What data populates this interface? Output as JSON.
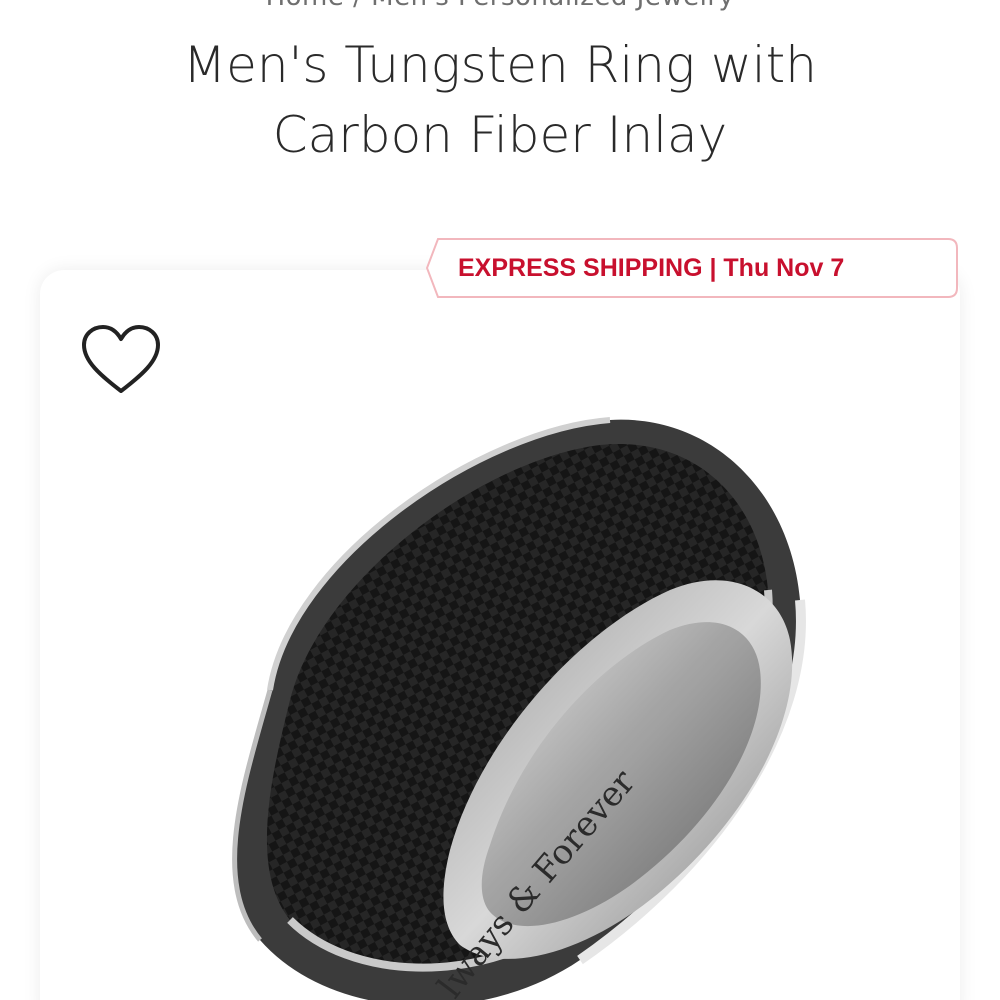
{
  "breadcrumb": {
    "text": "Home / Men's Personalized Jewelry"
  },
  "product": {
    "title_line1": "Men's Tungsten Ring with",
    "title_line2": "Carbon Fiber Inlay",
    "engraving": "Always & Forever",
    "engraving_visible": "lways & Forever"
  },
  "shipping_badge": {
    "text": "EXPRESS SHIPPING | Thu Nov 7",
    "color": "#c8102e"
  },
  "icons": {
    "favorite": "heart-outline-icon"
  },
  "colors": {
    "title": "#2a2a2a",
    "breadcrumb": "#6f6f6f",
    "accent": "#c8102e"
  }
}
